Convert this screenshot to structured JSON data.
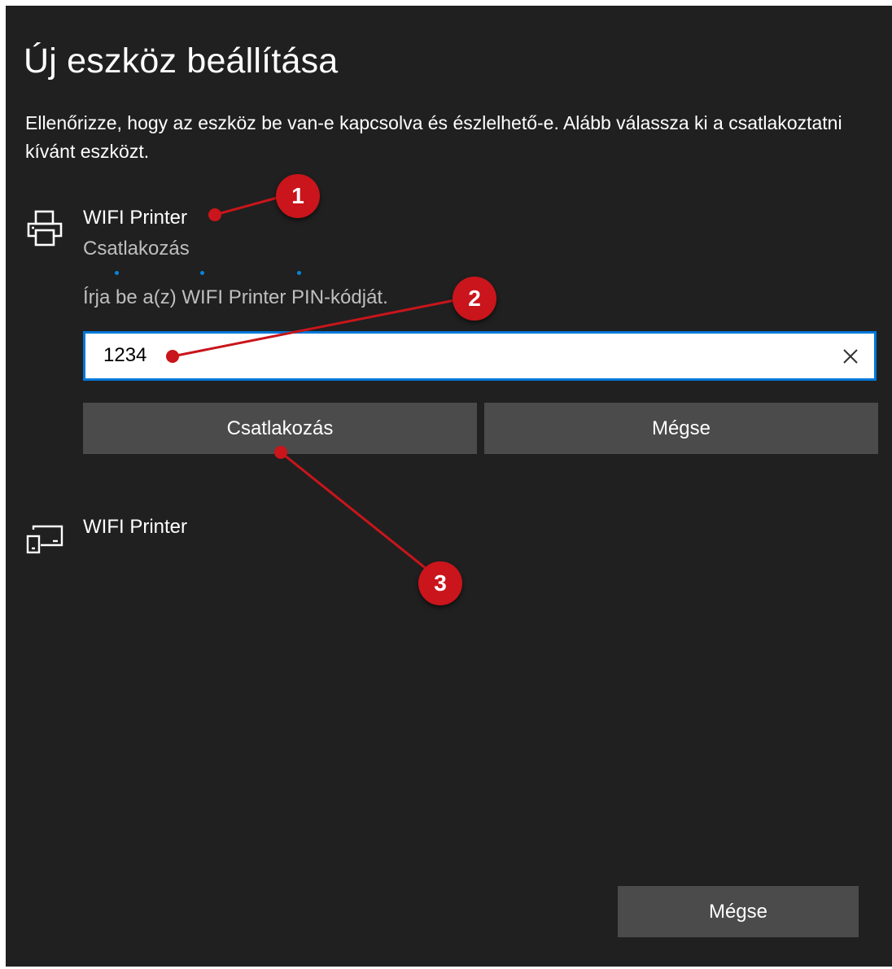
{
  "window": {
    "title": "Új eszköz beállítása",
    "description": "Ellenőrizze, hogy az eszköz be van-e kapcsolva és észlelhető-e. Alább válassza ki a csatlakoztatni kívánt eszközt."
  },
  "devices": [
    {
      "name": "WIFI Printer",
      "status": "Csatlakozás",
      "icon": "printer-icon",
      "pin_prompt": "Írja be a(z) WIFI Printer PIN-kódját.",
      "pin_value": "1234",
      "connect_label": "Csatlakozás",
      "cancel_label": "Mégse"
    },
    {
      "name": "WIFI Printer",
      "icon": "device-icon"
    }
  ],
  "footer": {
    "cancel_label": "Mégse"
  },
  "annotations": {
    "marker_1": "1",
    "marker_2": "2",
    "marker_3": "3",
    "color": "#c9151b"
  },
  "colors": {
    "background": "#202020",
    "accent": "#0078d7",
    "button": "#4b4b4b",
    "progress_dot": "#0a84d8"
  }
}
